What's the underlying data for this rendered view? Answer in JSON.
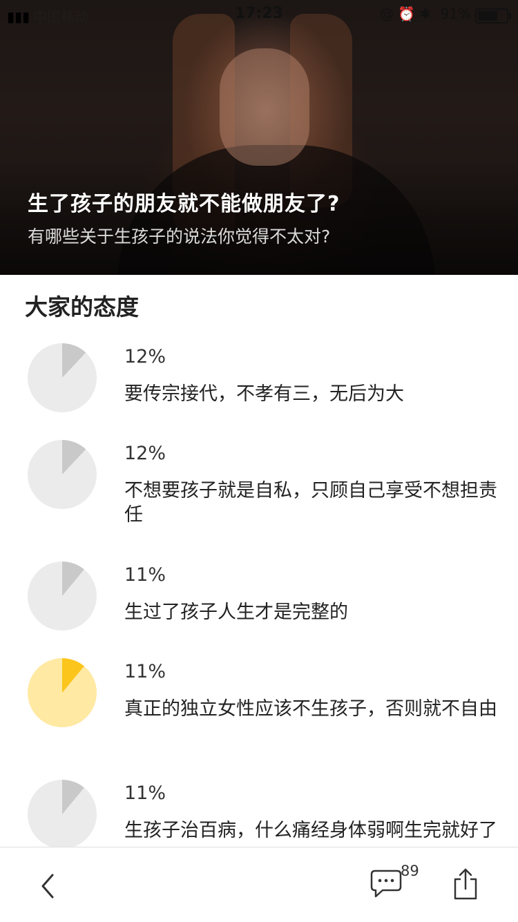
{
  "status_bar": {
    "carrier": "中国移动",
    "time": "17:23",
    "battery_percent": "91%"
  },
  "hero": {
    "title": "生了孩子的朋友就不能做朋友了?",
    "subtitle": "有哪些关于生孩子的说法你觉得不太对?"
  },
  "section_title": "大家的态度",
  "poll": [
    {
      "percent": "12%",
      "value": 0.12,
      "label": "要传宗接代，不孝有三，无后为大",
      "selected": false
    },
    {
      "percent": "12%",
      "value": 0.12,
      "label": "不想要孩子就是自私，只顾自己享受不想担责任",
      "selected": false
    },
    {
      "percent": "11%",
      "value": 0.11,
      "label": "生过了孩子人生才是完整的",
      "selected": false
    },
    {
      "percent": "11%",
      "value": 0.11,
      "label": "真正的独立女性应该不生孩子，否则就不自由",
      "selected": true
    },
    {
      "percent": "11%",
      "value": 0.11,
      "label": "生孩子治百病，什么痛经身体弱啊生完就好了",
      "selected": false
    }
  ],
  "colors": {
    "pie_base": "#ebebeb",
    "pie_slice": "#c9c9c9",
    "pie_base_selected": "#ffe9a3",
    "pie_slice_selected": "#fbc51b"
  },
  "bottom_bar": {
    "comment_count": "89",
    "icons": [
      "back-icon",
      "comment-icon",
      "share-icon"
    ]
  }
}
